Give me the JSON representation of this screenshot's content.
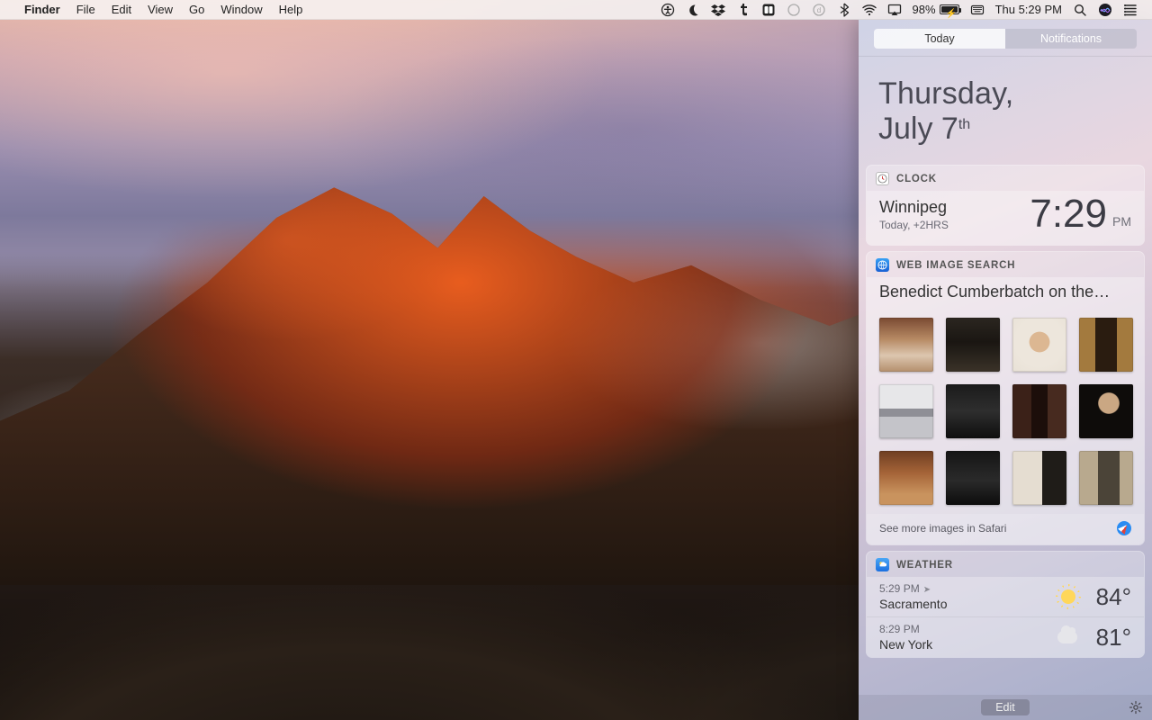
{
  "menubar": {
    "app": "Finder",
    "items": [
      "File",
      "Edit",
      "View",
      "Go",
      "Window",
      "Help"
    ],
    "battery_pct": "98%",
    "clock": "Thu 5:29 PM"
  },
  "nc": {
    "tabs": {
      "today": "Today",
      "notifications": "Notifications"
    },
    "date": {
      "weekday": "Thursday,",
      "month_day": "July 7",
      "ordinal": "th"
    },
    "clock": {
      "title": "CLOCK",
      "city": "Winnipeg",
      "offset": "Today, +2HRS",
      "time": "7:29",
      "ampm": "PM"
    },
    "web_image_search": {
      "title": "WEB IMAGE SEARCH",
      "query": "Benedict Cumberbatch on the…",
      "more_link": "See more images in Safari"
    },
    "weather": {
      "title": "WEATHER",
      "rows": [
        {
          "time": "5:29 PM",
          "current": true,
          "city": "Sacramento",
          "icon": "sun",
          "temp": "84°"
        },
        {
          "time": "8:29 PM",
          "current": false,
          "city": "New York",
          "icon": "cloud",
          "temp": "81°"
        }
      ]
    },
    "edit_label": "Edit"
  }
}
